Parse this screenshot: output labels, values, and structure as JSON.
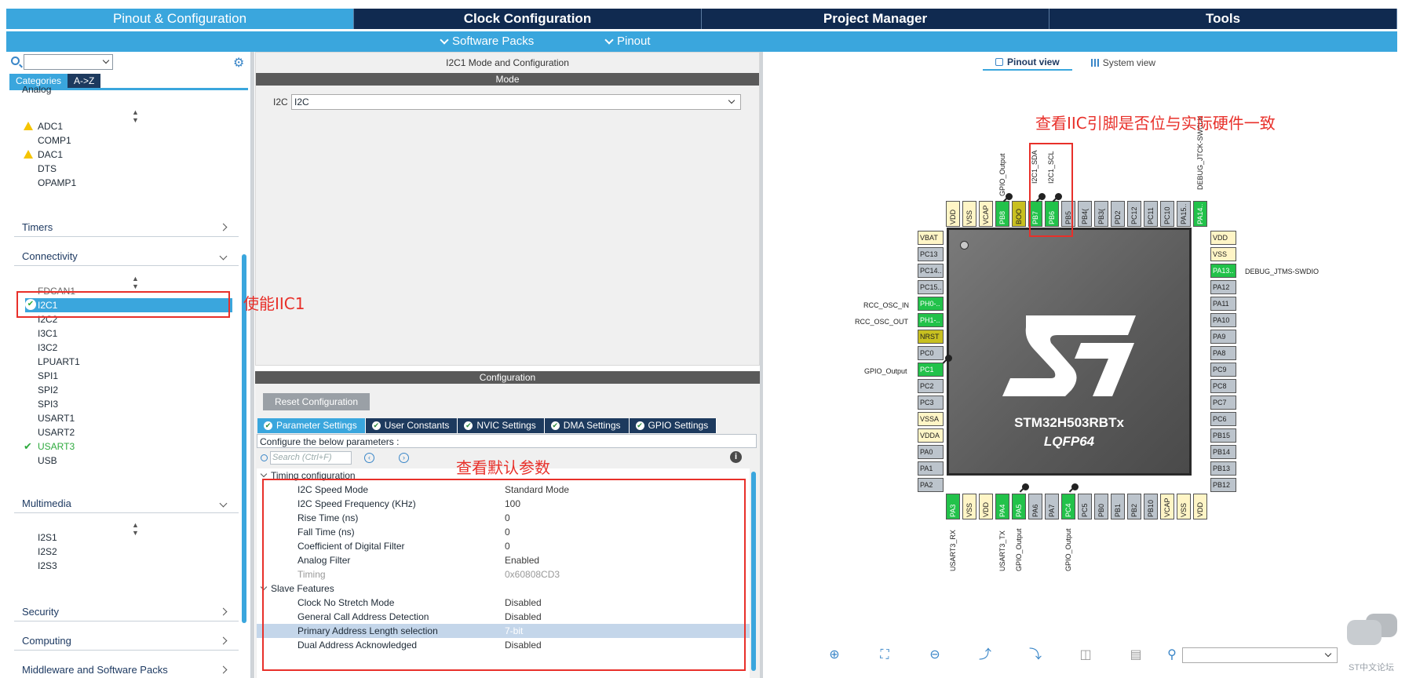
{
  "top_tabs": [
    "Pinout & Configuration",
    "Clock Configuration",
    "Project Manager",
    "Tools"
  ],
  "sub_menu": {
    "software_packs": "Software Packs",
    "pinout": "Pinout"
  },
  "left": {
    "view_tabs": [
      "Categories",
      "A->Z"
    ],
    "analog_header": "Analog",
    "analog_items": [
      "ADC1",
      "COMP1",
      "DAC1",
      "DTS",
      "OPAMP1"
    ],
    "timers": "Timers",
    "connectivity": "Connectivity",
    "connectivity_items": [
      "FDCAN1",
      "I2C1",
      "I2C2",
      "I3C1",
      "I3C2",
      "LPUART1",
      "SPI1",
      "SPI2",
      "SPI3",
      "USART1",
      "USART2",
      "USART3",
      "USB"
    ],
    "multimedia": "Multimedia",
    "multimedia_items": [
      "I2S1",
      "I2S2",
      "I2S3"
    ],
    "security": "Security",
    "computing": "Computing",
    "middleware": "Middleware and Software Packs"
  },
  "mid": {
    "title": "I2C1 Mode and Configuration",
    "mode_bar": "Mode",
    "i2c_label": "I2C",
    "i2c_value": "I2C",
    "config_bar": "Configuration",
    "reset_button": "Reset Configuration",
    "config_tabs": [
      "Parameter Settings",
      "User Constants",
      "NVIC Settings",
      "DMA Settings",
      "GPIO Settings"
    ],
    "configure_text": "Configure the below parameters :",
    "search_placeholder": "Search (Ctrl+F)",
    "sections": [
      {
        "name": "Timing configuration",
        "rows": [
          {
            "name": "I2C Speed Mode",
            "value": "Standard Mode"
          },
          {
            "name": "I2C Speed Frequency (KHz)",
            "value": "100"
          },
          {
            "name": "Rise Time (ns)",
            "value": "0"
          },
          {
            "name": "Fall Time (ns)",
            "value": "0"
          },
          {
            "name": "Coefficient of Digital Filter",
            "value": "0"
          },
          {
            "name": "Analog Filter",
            "value": "Enabled"
          },
          {
            "name": "Timing",
            "value": "0x60808CD3"
          }
        ]
      },
      {
        "name": "Slave Features",
        "rows": [
          {
            "name": "Clock No Stretch Mode",
            "value": "Disabled"
          },
          {
            "name": "General Call Address Detection",
            "value": "Disabled"
          },
          {
            "name": "Primary Address Length selection",
            "value": "7-bit"
          },
          {
            "name": "Dual Address Acknowledged",
            "value": "Disabled"
          }
        ]
      }
    ]
  },
  "right": {
    "view_toggle": [
      "Pinout view",
      "System view"
    ],
    "chip_name": "STM32H503RBTx",
    "package": "LQFP64",
    "left_pins": [
      "VBAT",
      "PC13",
      "PC14..",
      "PC15..",
      "PH0-..",
      "PH1-..",
      "NRST",
      "PC0",
      "PC1",
      "PC2",
      "PC3",
      "VSSA",
      "VDDA",
      "PA0",
      "PA1",
      "PA2"
    ],
    "right_pins": [
      "VDD",
      "VSS",
      "PA13..",
      "PA12",
      "PA11",
      "PA10",
      "PA9",
      "PA8",
      "PC9",
      "PC8",
      "PC7",
      "PC6",
      "PB15",
      "PB14",
      "PB13",
      "PB12"
    ],
    "top_pins": [
      "VDD",
      "VSS",
      "VCAP",
      "PB8",
      "BOO",
      "PB7",
      "PB6",
      "PB5",
      "PB4(",
      "PB3(",
      "PD2",
      "PC12",
      "PC11",
      "PC10",
      "PA15..",
      "PA14.."
    ],
    "bottom_pins": [
      "PA3",
      "VSS",
      "VDD",
      "PA4",
      "PA5",
      "PA6",
      "PA7",
      "PC4",
      "PC5",
      "PB0",
      "PB1",
      "PB2",
      "PB10",
      "VCAP",
      "VSS",
      "VDD"
    ],
    "pin_labels": {
      "debug_swclk": "DEBUG_JTCK-SWCLK",
      "debug_swdio": "DEBUG_JTMS-SWDIO",
      "gpio_output": "GPIO_Output",
      "i2c1_sda": "I2C1_SDA",
      "i2c1_scl": "I2C1_SCL",
      "rcc_osc_in": "RCC_OSC_IN",
      "rcc_osc_out": "RCC_OSC_OUT",
      "usart3_rx": "USART3_RX",
      "usart3_tx": "USART3_TX"
    }
  },
  "annotations": {
    "enable_iic": "使能IIC1",
    "check_pins": "查看IIC引脚是否位与实际硬件一致",
    "check_params": "查看默认参数"
  },
  "watermark": "ST中文论坛",
  "colors": {
    "accent": "#3aa6dd",
    "navy": "#102a50",
    "pin_green": "#22c24a",
    "annotation_red": "#e8302a"
  }
}
